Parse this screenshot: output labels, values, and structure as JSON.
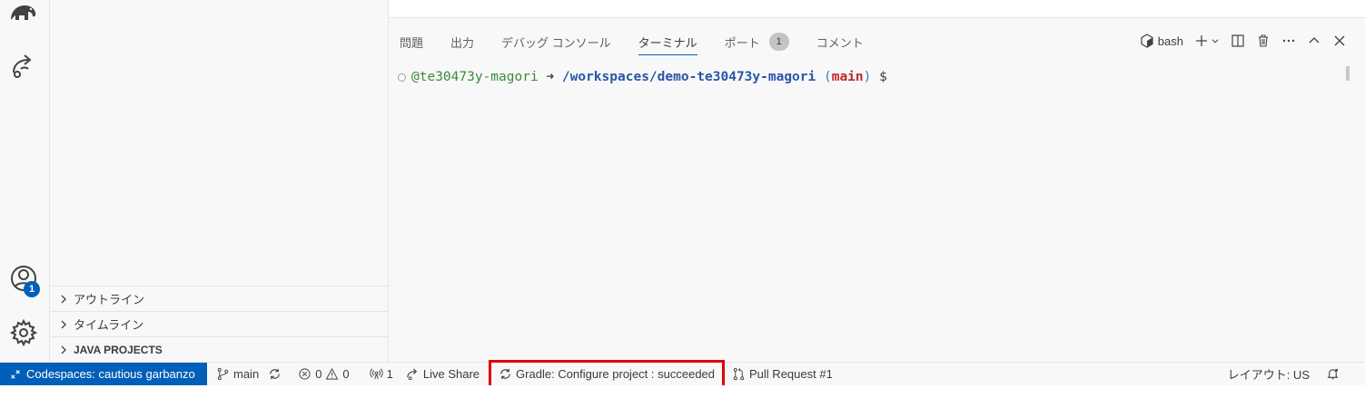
{
  "activity_bar": {
    "account_badge": "1"
  },
  "sidebar": {
    "sections": [
      {
        "label": "アウトライン"
      },
      {
        "label": "タイムライン"
      },
      {
        "label": "JAVA PROJECTS"
      }
    ]
  },
  "panel": {
    "tabs": [
      {
        "label": "問題"
      },
      {
        "label": "出力"
      },
      {
        "label": "デバッグ コンソール"
      },
      {
        "label": "ターミナル"
      },
      {
        "label": "ポート",
        "count": "1"
      },
      {
        "label": "コメント"
      }
    ],
    "toolbar": {
      "shell_label": "bash"
    },
    "terminal": {
      "user": "@te30473y-magori",
      "arrow": "➜",
      "path": "/workspaces/demo-te30473y-magori",
      "paren_open": "(",
      "branch": "main",
      "paren_close": ")",
      "prompt": "$"
    }
  },
  "statusbar": {
    "remote": "Codespaces: cautious garbanzo",
    "branch": "main",
    "errors": "0",
    "warnings": "0",
    "ports": "1",
    "live_share": "Live Share",
    "gradle": "Gradle: Configure project : succeeded",
    "pull_request": "Pull Request #1",
    "layout": "レイアウト: US"
  },
  "colors": {
    "accent": "#005fb8",
    "highlight": "#e00000"
  }
}
